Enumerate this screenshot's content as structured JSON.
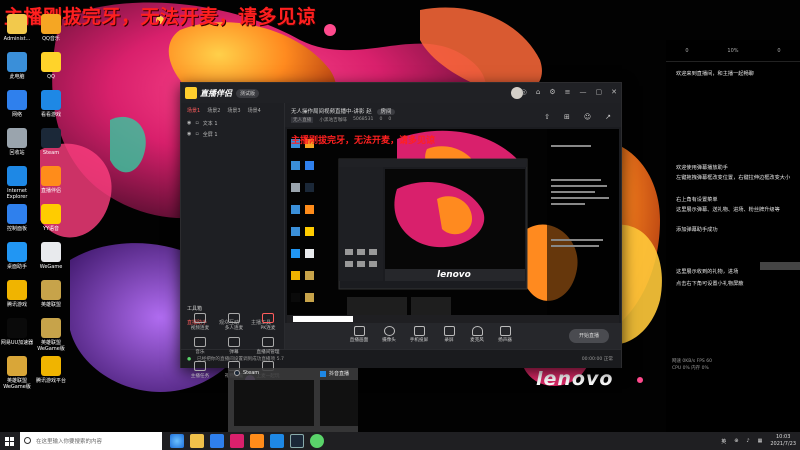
{
  "banner": {
    "text": "主播刚拔完牙，无法开麦，请多见谅"
  },
  "desktop_icons": [
    {
      "label": "Administ...",
      "color": "#f2c94c"
    },
    {
      "label": "QQ音乐",
      "color": "#f5a623"
    },
    {
      "label": "此电脑",
      "color": "#3a8fd9"
    },
    {
      "label": "QQ",
      "color": "#ffd32a"
    },
    {
      "label": "网络",
      "color": "#2f80ed"
    },
    {
      "label": "看看游戏",
      "color": "#1e88e5"
    },
    {
      "label": "回收站",
      "color": "#9aa4ad"
    },
    {
      "label": "Steam",
      "color": "#1b2838"
    },
    {
      "label": "Internet Explorer",
      "color": "#1e88e5"
    },
    {
      "label": "直播伴侣",
      "color": "#ff8c1a"
    },
    {
      "label": "控制面板",
      "color": "#2f80ed"
    },
    {
      "label": "YY语音",
      "color": "#ffcc00"
    },
    {
      "label": "桌面助手",
      "color": "#2196f3"
    },
    {
      "label": "WeGame",
      "color": "#e8eaed"
    },
    {
      "label": "腾讯游戏",
      "color": "#f0b400"
    },
    {
      "label": "英雄联盟",
      "color": "#c7a34a"
    },
    {
      "label": "网易UU加速器",
      "color": "#0a0a0a"
    },
    {
      "label": "英雄联盟WeGame版",
      "color": "#c7a34a"
    },
    {
      "label": "英雄联盟WeGame版",
      "color": "#d9a638"
    },
    {
      "label": "腾讯游戏平台",
      "color": "#f0b400"
    }
  ],
  "side_panel": {
    "stats": [
      "0",
      "10%",
      "0"
    ],
    "comments": [
      "欢迎来到直播间，和主播一起畅聊",
      "欢迎使用弹幕播放助手",
      "左键拖拽弹幕框改变位置，右键拉伸边框改变大小",
      "右上角有设置菜单",
      "这里展示弹幕、送礼物、进场、粉丝牌升级等",
      "添加弹幕助手成功",
      "这里展示收到的礼物，进场",
      "点击右下角可设置小礼物屏蔽"
    ],
    "footer_lines": [
      "网速 0KB/s  FPS 60",
      "CPU 0%  内存 0%"
    ]
  },
  "app": {
    "title": "直播伴侣",
    "version_badge": "测试版",
    "title_controls": [
      "◎",
      "⌂",
      "⚙",
      "≡",
      "—",
      "▢",
      "✕"
    ],
    "scene_tabs": [
      "场景1",
      "场景2",
      "场景3",
      "场景4"
    ],
    "sources": [
      {
        "name": "文本 1"
      },
      {
        "name": "全屏 1"
      }
    ],
    "tools_label": "工具箱",
    "tool_tabs": [
      "直播助手",
      "观众互动",
      "主播工具"
    ],
    "tools": [
      "视频连麦",
      "多人连麦",
      "PK连麦",
      "音乐",
      "弹幕",
      "直播间管理",
      "主播任务",
      "礼物设置",
      "上麦一起玩"
    ],
    "room_title": "无人操作局间视频直播中-讲影 赵",
    "room_badge": "房间",
    "room_info": [
      "无人直播",
      "小黑咕吉咖啡",
      "5068531",
      "0",
      "0"
    ],
    "header_icons": [
      "⇧",
      "⊞",
      "☺",
      "↗"
    ],
    "preview_banner": "主播刚拔完牙，无法开麦，请多见谅",
    "controls": [
      "直播画面",
      "摄像头",
      "手机投屏",
      "录屏",
      "麦克风",
      "扬声器"
    ],
    "live_button": "开始直播",
    "status_text": "已经把你的直播间设置调到成功直播项 5.7",
    "status_right": "00:00:00  正常"
  },
  "thumbs": [
    {
      "title": "Steam"
    },
    {
      "title": "抖音直播"
    }
  ],
  "taskbar": {
    "search_placeholder": "在这里输入你要搜索的内容",
    "time": "10:03",
    "date": "2021/7/23",
    "tray_icons": [
      "英",
      "⊕",
      "♪",
      "▦"
    ]
  }
}
